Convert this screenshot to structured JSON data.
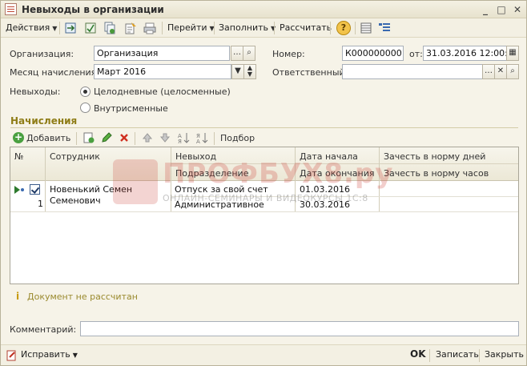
{
  "window": {
    "title": "Невыходы в организации"
  },
  "toolbar": {
    "actions": "Действия",
    "goto": "Перейти",
    "fill": "Заполнить",
    "calculate": "Рассчитать",
    "help": "?"
  },
  "form": {
    "org_label": "Организация:",
    "org_value": "Организация",
    "month_label": "Месяц начисления:",
    "month_value": "Март 2016",
    "number_label": "Номер:",
    "number_value": "К0000000001",
    "from_label": "от:",
    "date_value": "31.03.2016 12:00:00",
    "responsible_label": "Ответственный:",
    "responsible_value": "",
    "absences_label": "Невыходы:",
    "radio_full_day": "Целодневные (целосменные)",
    "radio_intra_shift": "Внутрисменные"
  },
  "section": {
    "title": "Начисления",
    "add": "Добавить",
    "pick": "Подбор"
  },
  "grid": {
    "headers": {
      "num": "№",
      "employee": "Сотрудник",
      "absence": "Невыход",
      "department": "Подразделение",
      "date_start": "Дата начала",
      "date_end": "Дата окончания",
      "norm_days": "Зачесть в норму дней",
      "norm_hours": "Зачесть в норму часов"
    },
    "rows": [
      {
        "num": "1",
        "employee_line1": "Новенький Семен",
        "employee_line2": "Семенович",
        "absence": "Отпуск за свой счет",
        "department": "Административное",
        "date_start": "01.03.2016",
        "date_end": "30.03.2016",
        "norm_days": "",
        "norm_hours": ""
      }
    ]
  },
  "watermark": {
    "brand": "ПРОФБУХ8.ру",
    "subtitle": "ОНЛАЙН-СЕМИНАРЫ И ВИДЕОКУРСЫ 1С:8"
  },
  "status": {
    "icon": "i",
    "text": "Документ не рассчитан"
  },
  "comment": {
    "label": "Комментарий:",
    "value": ""
  },
  "bottom": {
    "fix": "Исправить",
    "ok": "OK",
    "save": "Записать",
    "close": "Закрыть"
  },
  "colors": {
    "section_title": "#8f7d17",
    "status_text": "#9a8a2e",
    "watermark": "#cd3c32"
  }
}
